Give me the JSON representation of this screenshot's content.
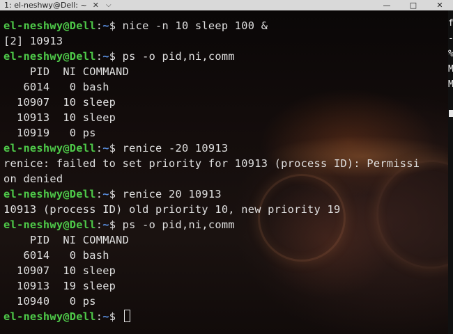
{
  "window": {
    "tab_title": "1: el-neshwy@Dell: ~",
    "tab_close": "✕",
    "tab_dropdown": "⌵",
    "minimize": "—",
    "maximize": "□",
    "close": "✕"
  },
  "prompt": {
    "user": "el-neshwy@Dell",
    "sep": ":",
    "path": "~",
    "symbol": "$ "
  },
  "terminal": {
    "cmd1": "nice -n 10 sleep 100 &",
    "out1": "[2] 10913",
    "cmd2": "ps -o pid,ni,comm",
    "ps1": [
      "    PID  NI COMMAND",
      "   6014   0 bash",
      "  10907  10 sleep",
      "  10913  10 sleep",
      "  10919   0 ps"
    ],
    "cmd3": "renice -20 10913",
    "err1": "renice: failed to set priority for 10913 (process ID): Permissi",
    "err2": "on denied",
    "cmd4": "renice 20 10913",
    "out2": "10913 (process ID) old priority 10, new priority 19",
    "cmd5": "ps -o pid,ni,comm",
    "ps2": [
      "    PID  NI COMMAND",
      "   6014   0 bash",
      "  10907  10 sleep",
      "  10913  19 sleep",
      "  10940   0 ps"
    ]
  },
  "side_glyphs": [
    "f",
    "-",
    "%",
    "M",
    "M"
  ],
  "colors": {
    "user": "#4ec949",
    "path": "#5a8fe0",
    "text": "#e0e0e0"
  }
}
